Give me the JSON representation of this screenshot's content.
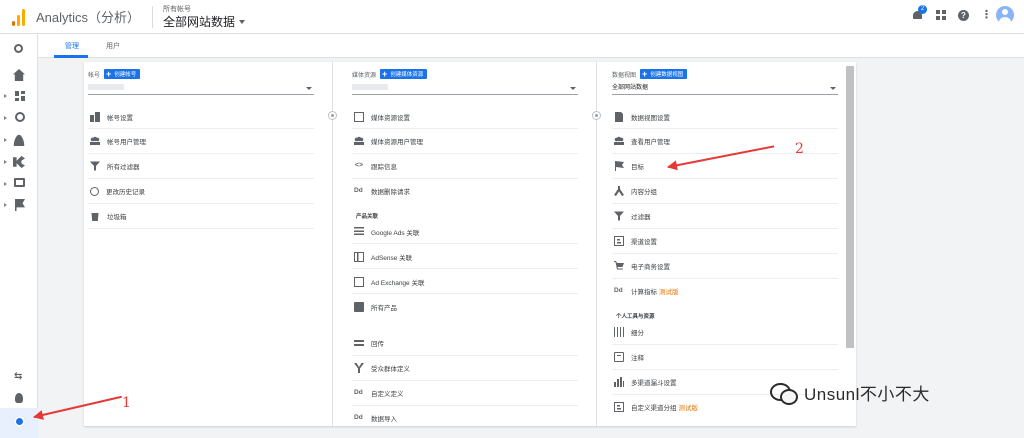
{
  "header": {
    "app_title": "Analytics（分析）",
    "account_small": "所有帐号",
    "account_main": "全部网站数据",
    "notification_count": "2",
    "help": "?"
  },
  "tabs": [
    {
      "label": "管理",
      "active": true
    },
    {
      "label": "用户",
      "active": false
    }
  ],
  "columns": {
    "account": {
      "label": "帐号",
      "create": "创建帐号",
      "selected": "",
      "items": [
        "帐号设置",
        "帐号用户管理",
        "所有过滤器",
        "更改历史记录",
        "垃圾箱"
      ]
    },
    "property": {
      "label": "媒体资源",
      "create": "创建媒体资源",
      "selected": "",
      "items": [
        "媒体资源设置",
        "媒体资源用户管理",
        "跟踪信息",
        "数据删除请求"
      ],
      "section": "产品关联",
      "section_items": [
        "Google Ads 关联",
        "AdSense 关联",
        "Ad Exchange 关联",
        "所有产品"
      ],
      "extra_items": [
        "回传",
        "受众群体定义",
        "自定义定义",
        "数据导入"
      ],
      "dd_glyph": "Dd",
      "code_glyph": "<>"
    },
    "view": {
      "label": "数据视图",
      "create": "创建数据视图",
      "selected": "全部网站数据",
      "items": [
        "数据视图设置",
        "查看用户管理",
        "目标",
        "内容分组",
        "过滤器",
        "渠道设置",
        "电子商务设置"
      ],
      "calc_metrics": "计算指标",
      "beta": "测试版",
      "section": "个人工具与资源",
      "section_items": [
        "细分",
        "注释",
        "多渠道漏斗设置"
      ],
      "custom_channel": "自定义渠道分组",
      "dd_glyph": "Dd"
    }
  },
  "annotations": {
    "one": "1",
    "two": "2"
  },
  "watermark": "Unsunl不小不大",
  "colors": {
    "accent": "#1a73e8",
    "annotation": "#e53935",
    "beta": "#e37400"
  }
}
